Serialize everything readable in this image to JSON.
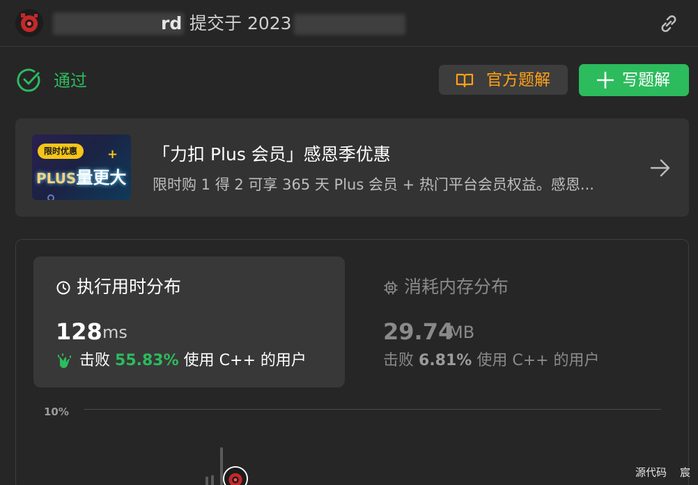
{
  "header": {
    "username_visible_suffix": "rd",
    "submitted_text": "提交于 2023",
    "link_icon": "link-icon",
    "avatar_icon": "user-avatar"
  },
  "status": {
    "label": "通过",
    "icon": "check-circle-icon",
    "color": "#2cbb5d"
  },
  "actions": {
    "official_solution_label": "官方题解",
    "official_solution_icon": "book-icon",
    "write_solution_label": "写题解",
    "write_solution_icon": "plus-icon"
  },
  "promo": {
    "badge": "限时优惠",
    "slogan_plus": "PLUS",
    "slogan_text": "量更大",
    "title": "「力扣 Plus 会员」感恩季优惠",
    "subtitle": "限时购 1 得 2 可享 365 天 Plus 会员 + 热门平台会员权益。感恩...",
    "arrow_icon": "arrow-right-icon"
  },
  "runtime": {
    "title": "执行用时分布",
    "icon": "clock-icon",
    "value": "128",
    "unit": "ms",
    "beats_label": "击败",
    "beats_percent": "55.83%",
    "users_text": "使用 C++ 的用户",
    "beats_icon": "clapping-hands-icon"
  },
  "memory": {
    "title": "消耗内存分布",
    "icon": "chip-icon",
    "value": "29.74",
    "unit": "MB",
    "beats_label": "击败",
    "beats_percent": "6.81%",
    "users_text": "使用 C++ 的用户"
  },
  "chart": {
    "tick_label": "10%"
  },
  "footer": {
    "source_code_label": "源代码",
    "char_label": "宸"
  },
  "colors": {
    "accent_green": "#2cbb5d",
    "accent_orange": "#ffa116",
    "background": "#262626"
  }
}
